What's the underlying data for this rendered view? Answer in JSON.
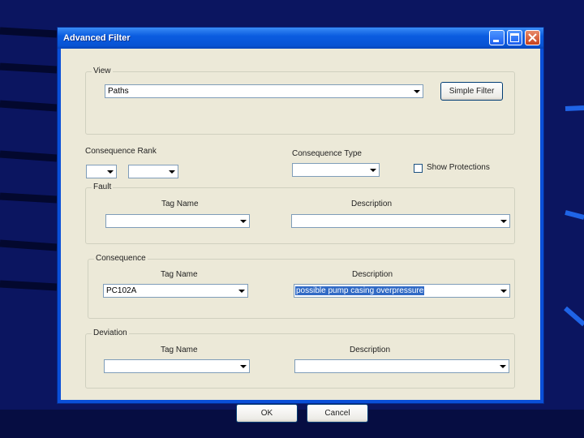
{
  "window": {
    "title": "Advanced Filter"
  },
  "view": {
    "legend": "View",
    "value": "Paths",
    "simple_filter_button": "Simple Filter"
  },
  "consequence_rank": {
    "label": "Consequence Rank",
    "value1": "",
    "value2": ""
  },
  "consequence_type": {
    "label": "Consequence Type",
    "value": ""
  },
  "show_protections": {
    "label": "Show Protections",
    "checked": false
  },
  "fault": {
    "legend": "Fault",
    "tag_name_label": "Tag Name",
    "description_label": "Description",
    "tag_name_value": "",
    "description_value": ""
  },
  "consequence": {
    "legend": "Consequence",
    "tag_name_label": "Tag Name",
    "description_label": "Description",
    "tag_name_value": "PC102A",
    "description_value": "possible pump casing overpressure"
  },
  "deviation": {
    "legend": "Deviation",
    "tag_name_label": "Tag Name",
    "description_label": "Description",
    "tag_name_value": "",
    "description_value": ""
  },
  "buttons": {
    "ok": "OK",
    "cancel": "Cancel"
  },
  "colors": {
    "titlebar": "#0a5ce0",
    "dialog_bg": "#ece9d8",
    "desktop_bg": "#0b1560"
  }
}
